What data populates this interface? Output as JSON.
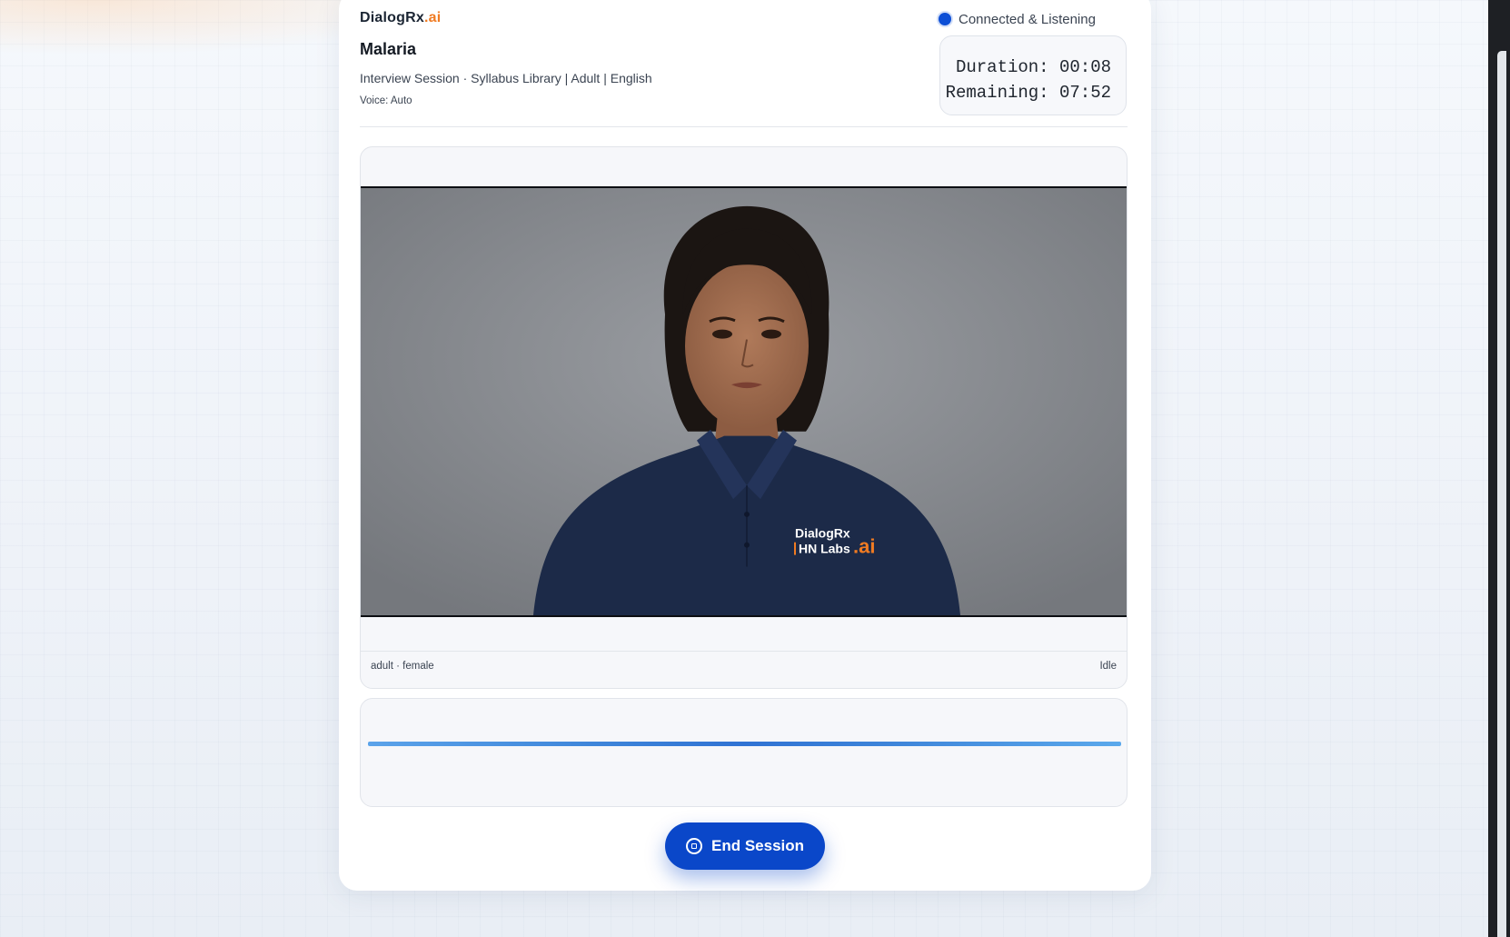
{
  "brand": {
    "name": "DialogRx",
    "suffix": ".ai"
  },
  "session": {
    "title": "Malaria",
    "subtitle": "Interview Session · Syllabus Library | Adult | English",
    "voice": "Voice: Auto"
  },
  "status": {
    "label": "Connected & Listening",
    "color": "#0d4fd6"
  },
  "timer": {
    "duration": "Duration: 00:08",
    "remaining": "Remaining: 07:52"
  },
  "avatar": {
    "shirt_logo_line1": "DialogRx",
    "shirt_logo_line2": "HN Labs",
    "shirt_logo_suffix": ".ai",
    "profile": "adult · female",
    "state": "Idle"
  },
  "actions": {
    "end_session": "End Session",
    "end_icon": "stop-circle-icon"
  },
  "colors": {
    "accent": "#0a47c9",
    "brand_orange": "#f07b22"
  }
}
